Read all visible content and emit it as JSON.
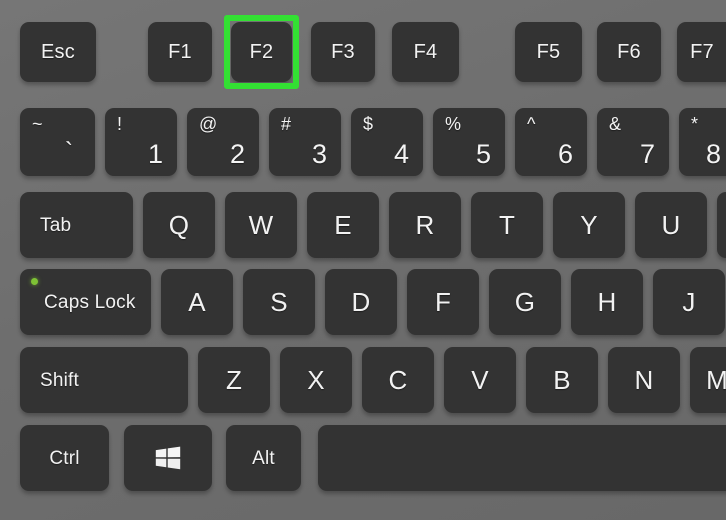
{
  "scene": {
    "title": "Windows keyboard with F2 key highlighted",
    "background_color": "#6e6e6e",
    "keycap_color": "#333333",
    "label_color": "#f2f2f2",
    "highlight_color": "#33e033",
    "led_color": "#7ec235"
  },
  "highlight": {
    "key": "F2",
    "shape": "rectangle-outline",
    "color": "#33e033",
    "border_width_px": 6
  },
  "rows": [
    {
      "name": "function-row",
      "keys": [
        {
          "label": "Esc",
          "name": "escape"
        },
        {
          "label": "F1",
          "name": "f1"
        },
        {
          "label": "F2",
          "name": "f2",
          "highlighted": true
        },
        {
          "label": "F3",
          "name": "f3"
        },
        {
          "label": "F4",
          "name": "f4"
        },
        {
          "label": "F5",
          "name": "f5"
        },
        {
          "label": "F6",
          "name": "f6"
        },
        {
          "label": "F7",
          "name": "f7",
          "clipped": true
        }
      ]
    },
    {
      "name": "number-row",
      "keys": [
        {
          "shift": "~",
          "label": "`",
          "name": "backtick"
        },
        {
          "shift": "!",
          "label": "1",
          "name": "one"
        },
        {
          "shift": "@",
          "label": "2",
          "name": "two"
        },
        {
          "shift": "#",
          "label": "3",
          "name": "three"
        },
        {
          "shift": "$",
          "label": "4",
          "name": "four"
        },
        {
          "shift": "%",
          "label": "5",
          "name": "five"
        },
        {
          "shift": "^",
          "label": "6",
          "name": "six"
        },
        {
          "shift": "&",
          "label": "7",
          "name": "seven"
        },
        {
          "shift": "*",
          "label": "8",
          "name": "eight",
          "clipped": true
        }
      ]
    },
    {
      "name": "top-letter-row",
      "keys": [
        {
          "label": "Tab",
          "name": "tab"
        },
        {
          "label": "Q",
          "name": "q"
        },
        {
          "label": "W",
          "name": "w"
        },
        {
          "label": "E",
          "name": "e"
        },
        {
          "label": "R",
          "name": "r"
        },
        {
          "label": "T",
          "name": "t"
        },
        {
          "label": "Y",
          "name": "y"
        },
        {
          "label": "U",
          "name": "u"
        },
        {
          "label": "",
          "name": "i",
          "clipped": true
        }
      ]
    },
    {
      "name": "home-row",
      "keys": [
        {
          "label": "Caps Lock",
          "name": "caps-lock",
          "led": true
        },
        {
          "label": "A",
          "name": "a"
        },
        {
          "label": "S",
          "name": "s"
        },
        {
          "label": "D",
          "name": "d"
        },
        {
          "label": "F",
          "name": "f"
        },
        {
          "label": "G",
          "name": "g"
        },
        {
          "label": "H",
          "name": "h"
        },
        {
          "label": "J",
          "name": "j"
        }
      ]
    },
    {
      "name": "bottom-letter-row",
      "keys": [
        {
          "label": "Shift",
          "name": "shift"
        },
        {
          "label": "Z",
          "name": "z"
        },
        {
          "label": "X",
          "name": "x"
        },
        {
          "label": "C",
          "name": "c"
        },
        {
          "label": "V",
          "name": "v"
        },
        {
          "label": "B",
          "name": "b"
        },
        {
          "label": "N",
          "name": "n"
        },
        {
          "label": "M",
          "name": "m",
          "clipped": true
        }
      ]
    },
    {
      "name": "modifier-row",
      "keys": [
        {
          "label": "Ctrl",
          "name": "ctrl"
        },
        {
          "label": "",
          "name": "windows",
          "icon": "windows-logo-icon"
        },
        {
          "label": "Alt",
          "name": "alt"
        },
        {
          "label": "",
          "name": "spacebar",
          "clipped": true
        }
      ]
    }
  ]
}
